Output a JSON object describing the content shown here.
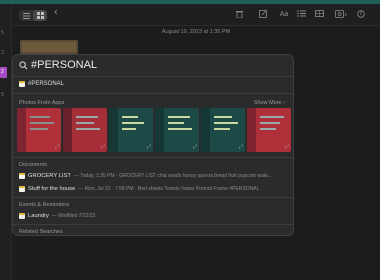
{
  "colors": {
    "accent": "#1f5f56",
    "tag_highlight": "#a64cc6",
    "photo_red": "#b0303a",
    "photo_teal": "#1d4a46"
  },
  "left_strip": {
    "numbers": [
      "5",
      "2",
      "5"
    ],
    "active": "2"
  },
  "toolbar": {
    "icons": [
      "list-view-icon",
      "grid-view-icon",
      "back-chevron-icon",
      "trash-icon",
      "compose-icon",
      "format-text-icon",
      "checklist-icon",
      "table-icon",
      "attachment-icon",
      "share-icon"
    ],
    "glyphs": {
      "aa": "Aa",
      "back": "‹"
    }
  },
  "note": {
    "date": "August 19, 2023 at 1:35 PM"
  },
  "spotlight": {
    "query": "#PERSONAL",
    "top_hit": "#PERSONAL",
    "photos_title": "Photos From Apps",
    "show_more": "Show More",
    "documents_title": "Documents",
    "documents": [
      {
        "title": "GROCERY LIST",
        "subtitle": "— Today, 1:35 PM · GROCERY LIST chia seeds honey quinoa bread fruit popcorn wate..."
      },
      {
        "title": "Stuff for the house",
        "subtitle": "— Mon, Jul 31 · 7:58 PM · Bed sheets Towels Vases Portrait Frame #PERSONAL"
      }
    ],
    "events_title": "Events & Reminders",
    "events": [
      {
        "title": "Laundry",
        "subtitle": "— Modified 7/22/23"
      }
    ],
    "related_title": "Related Searches"
  }
}
